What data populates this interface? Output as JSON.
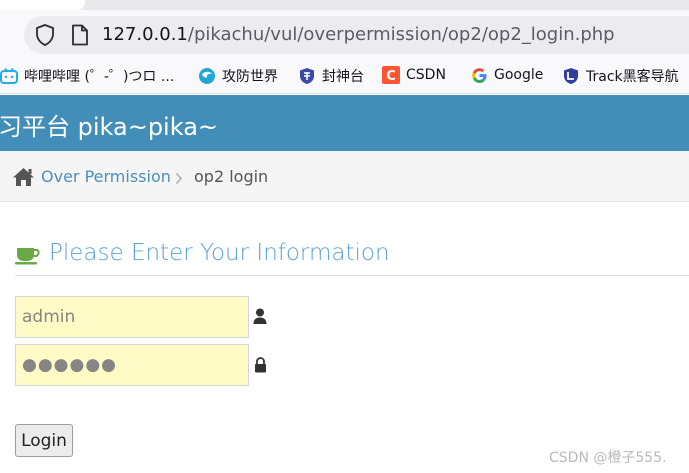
{
  "browser": {
    "url_host": "127.0.0.1",
    "url_path": "/pikachu/vul/overpermission/op2/op2_login.php",
    "bookmarks": [
      {
        "label": "哔哩哔哩 (゜-゜)つロ ...",
        "icon": "bilibili-icon"
      },
      {
        "label": "攻防世界",
        "icon": "xctf-icon"
      },
      {
        "label": "封神台",
        "icon": "shield-icon"
      },
      {
        "label": "CSDN",
        "icon": "csdn-icon"
      },
      {
        "label": "Google",
        "icon": "google-icon"
      },
      {
        "label": "Track黑客导航",
        "icon": "track-shield-icon"
      }
    ]
  },
  "header": {
    "title": "习平台 pika~pika~"
  },
  "breadcrumb": {
    "parent": "Over Permission",
    "current": "op2 login"
  },
  "main": {
    "heading": "Please Enter Your Information",
    "username_value": "admin",
    "password_value": "●●●●●●",
    "login_label": "Login"
  },
  "watermark": "CSDN @橙子555.",
  "colors": {
    "header_bg": "#438eb9",
    "link": "#4c8fbd",
    "heading": "#5ba1d2",
    "input_bg": "#fffbc7",
    "coffee_icon": "#69aa46"
  }
}
